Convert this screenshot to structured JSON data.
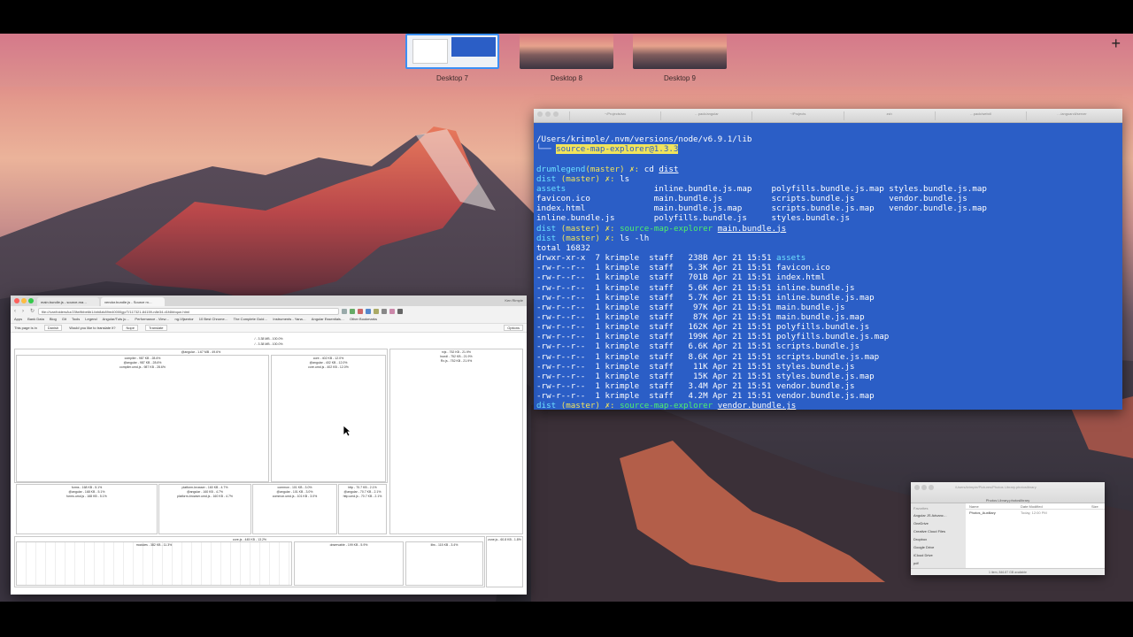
{
  "spaces": [
    {
      "label": "Desktop 7",
      "active": true
    },
    {
      "label": "Desktop 8",
      "active": false
    },
    {
      "label": "Desktop 9",
      "active": false
    }
  ],
  "add_space_icon": "plus-icon",
  "terminal": {
    "tab_labels": [
      "~/Projects/src",
      "…pack/angular",
      "~/Projects",
      "zsh",
      "…pack/webdl",
      "…/anguarcli/server"
    ],
    "line_path": "/Users/krimple/.nvm/versions/node/v6.9.1/lib",
    "line_pkg_prefix": "└── ",
    "line_pkg": "source-map-explorer@1.3.3",
    "prompt_user": "drumlegend",
    "prompt_branch": "(master)",
    "prompt_dir": "dist",
    "prompt_mark": " ✗: ",
    "cmd_cd": "cd ",
    "cmd_cd_arg": "dist",
    "cmd_ls": "ls",
    "ls_output": [
      [
        "assets",
        "inline.bundle.js.map",
        "polyfills.bundle.js.map",
        "styles.bundle.js.map"
      ],
      [
        "favicon.ico",
        "main.bundle.js",
        "scripts.bundle.js",
        "vendor.bundle.js"
      ],
      [
        "index.html",
        "main.bundle.js.map",
        "scripts.bundle.js.map",
        "vendor.bundle.js.map"
      ],
      [
        "inline.bundle.js",
        "polyfills.bundle.js",
        "styles.bundle.js",
        ""
      ]
    ],
    "cmd_sme": "source-map-explorer ",
    "cmd_sme_arg1": "main.bundle.js",
    "cmd_lslh": "ls -lh",
    "total": "total 16832",
    "lslh_rows": [
      [
        "drwxr-xr-x",
        "7",
        "krimple",
        "staff",
        "238B",
        "Apr 21 15:51",
        "assets"
      ],
      [
        "-rw-r--r--",
        "1",
        "krimple",
        "staff",
        "5.3K",
        "Apr 21 15:51",
        "favicon.ico"
      ],
      [
        "-rw-r--r--",
        "1",
        "krimple",
        "staff",
        "701B",
        "Apr 21 15:51",
        "index.html"
      ],
      [
        "-rw-r--r--",
        "1",
        "krimple",
        "staff",
        "5.6K",
        "Apr 21 15:51",
        "inline.bundle.js"
      ],
      [
        "-rw-r--r--",
        "1",
        "krimple",
        "staff",
        "5.7K",
        "Apr 21 15:51",
        "inline.bundle.js.map"
      ],
      [
        "-rw-r--r--",
        "1",
        "krimple",
        "staff",
        "97K",
        "Apr 21 15:51",
        "main.bundle.js"
      ],
      [
        "-rw-r--r--",
        "1",
        "krimple",
        "staff",
        "87K",
        "Apr 21 15:51",
        "main.bundle.js.map"
      ],
      [
        "-rw-r--r--",
        "1",
        "krimple",
        "staff",
        "162K",
        "Apr 21 15:51",
        "polyfills.bundle.js"
      ],
      [
        "-rw-r--r--",
        "1",
        "krimple",
        "staff",
        "199K",
        "Apr 21 15:51",
        "polyfills.bundle.js.map"
      ],
      [
        "-rw-r--r--",
        "1",
        "krimple",
        "staff",
        "6.6K",
        "Apr 21 15:51",
        "scripts.bundle.js"
      ],
      [
        "-rw-r--r--",
        "1",
        "krimple",
        "staff",
        "8.6K",
        "Apr 21 15:51",
        "scripts.bundle.js.map"
      ],
      [
        "-rw-r--r--",
        "1",
        "krimple",
        "staff",
        "11K",
        "Apr 21 15:51",
        "styles.bundle.js"
      ],
      [
        "-rw-r--r--",
        "1",
        "krimple",
        "staff",
        "15K",
        "Apr 21 15:51",
        "styles.bundle.js.map"
      ],
      [
        "-rw-r--r--",
        "1",
        "krimple",
        "staff",
        "3.4M",
        "Apr 21 15:51",
        "vendor.bundle.js"
      ],
      [
        "-rw-r--r--",
        "1",
        "krimple",
        "staff",
        "4.2M",
        "Apr 21 15:51",
        "vendor.bundle.js.map"
      ]
    ],
    "cmd_sme_arg2": "vendor.bundle.js"
  },
  "chrome": {
    "tabs": [
      "main.bundle.js - source-ma…",
      "vendor.bundle.js - Source m…"
    ],
    "profile": "Ken Rimple",
    "url": "file:///var/folders/kz/23fw9bbe6b14nh8zk89m40000gp/T/117321-84159-n8e34.d1f4lbbqun.html",
    "bookmarks": [
      "Apps",
      "Bank Data",
      "Blog",
      "Git",
      "Tools",
      "Legend",
      "Angular/Tuts ju…",
      "Performance - View…",
      "ng-Vijsentor",
      "10 Best Chrome…",
      "The Complete Guid…",
      "Instruments - Yana…",
      "Angular Essentials…",
      "Other Bookmarks"
    ],
    "translate": {
      "prefix": "This page is in",
      "lang": "Danish",
      "question": "Would you like to translate it?",
      "nope": "Nope",
      "yes": "Translate",
      "options": "Options"
    },
    "treemap": {
      "top1": "/ - 3.38 MB - 100.0%",
      "top2": "/ - 3.38 MB - 100.0%",
      "angular": "@angular - 1.67 MB - 49.6%",
      "compiler": "compiler - 987 KB - 28.6%",
      "compiler_sub": "@angular - 987 KB - 28.6%",
      "compiler_file": "compiler.umd.js - 987 KB - 28.6%",
      "core": "core - 402 KB - 12.0%",
      "core_sub": "@angular - 402 KB - 12.0%",
      "core_file": "core.umd.js - 402 KB - 12.0%",
      "rxjs": "rxjs - 752 KB - 21.9%",
      "rxjs_sub": "bundl - 752 KB - 21.9%",
      "rxjs_file": "Rx.js - 752 KB - 21.9%",
      "forms": "forms - 168 KB - 5.1%",
      "forms_sub": "@angular - 168 KB - 5.1%",
      "forms_file": "forms.umd.js - 168 KB - 5.1%",
      "pb": "platform-browser - 160 KB - 4.7%",
      "pb_sub": "@angular - 160 KB - 4.7%",
      "pb_file": "platform-browser.umd.js - 160 KB - 4.7%",
      "common": "common - 101 KB - 3.0%",
      "common_sub": "@angular - 101 KB - 3.0%",
      "common_file": "common.umd.js - 101 KB - 3.0%",
      "http": "http - 70.7 KB - 2.1%",
      "http_sub": "@angular - 70.7 KB - 2.1%",
      "http_file": "http.umd.js - 70.7 KB - 2.1%",
      "corejs": "core-js - 445 KB - 13.2%",
      "corejs_sub": "modules - 382 KB - 11.3%",
      "observable": "observable - 199 KB - 5.9%",
      "libs": "libs - 115 KB - 3.4%",
      "zone": "zone.js - 60.8 KB - 1.8%"
    }
  },
  "finder": {
    "path": "/Users/krimple/Pictures/Photos Library.photoslibrary",
    "title": "Photos Library.photoslibrary",
    "sidebar_header": "Favorites",
    "sidebar": [
      "Angular JS Advanc…",
      "OneDrive",
      "Creative Cloud Files",
      "Dropbox",
      "Google Drive",
      "iCloud Drive",
      "pdf"
    ],
    "col_name": "Name",
    "col_date": "Date Modified",
    "col_size": "Size",
    "file_name": "Photos_Auxiliary",
    "file_date": "Today, 12:00 PM",
    "status": "1 item, 846.87 GB available"
  }
}
